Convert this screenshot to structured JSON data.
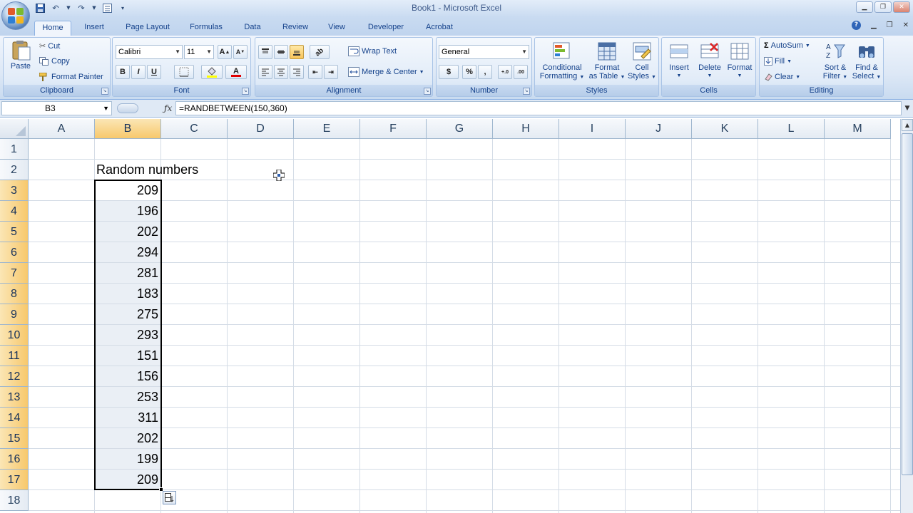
{
  "window": {
    "title": "Book1 - Microsoft Excel"
  },
  "tabs": [
    "Home",
    "Insert",
    "Page Layout",
    "Formulas",
    "Data",
    "Review",
    "View",
    "Developer",
    "Acrobat"
  ],
  "ribbon": {
    "clipboard": {
      "label": "Clipboard",
      "paste": "Paste",
      "cut": "Cut",
      "copy": "Copy",
      "format_painter": "Format Painter"
    },
    "font": {
      "label": "Font",
      "font_name": "Calibri",
      "font_size": "11",
      "bold": "B",
      "italic": "I",
      "underline": "U",
      "grow": "A",
      "shrink": "A",
      "font_color": "A"
    },
    "alignment": {
      "label": "Alignment",
      "wrap_text": "Wrap Text",
      "merge_center": "Merge & Center"
    },
    "number": {
      "label": "Number",
      "format": "General",
      "currency": "$",
      "percent": "%",
      "comma": ",",
      "inc_decimal": "+.0",
      "dec_decimal": ".00"
    },
    "styles": {
      "label": "Styles",
      "conditional_formatting": [
        "Conditional",
        "Formatting"
      ],
      "format_as_table": [
        "Format",
        "as Table"
      ],
      "cell_styles": [
        "Cell",
        "Styles"
      ]
    },
    "cells": {
      "label": "Cells",
      "insert": "Insert",
      "delete": "Delete",
      "format": "Format"
    },
    "editing": {
      "label": "Editing",
      "autosum": "AutoSum",
      "fill": "Fill",
      "clear": "Clear",
      "sort_filter": [
        "Sort &",
        "Filter"
      ],
      "find_select": [
        "Find &",
        "Select"
      ]
    }
  },
  "formula_bar": {
    "name_box": "B3",
    "formula": "=RANDBETWEEN(150,360)"
  },
  "sheet": {
    "columns": [
      "A",
      "B",
      "C",
      "D",
      "E",
      "F",
      "G",
      "H",
      "I",
      "J",
      "K",
      "L",
      "M"
    ],
    "rows": [
      "1",
      "2",
      "3",
      "4",
      "5",
      "6",
      "7",
      "8",
      "9",
      "10",
      "11",
      "12",
      "13",
      "14",
      "15",
      "16",
      "17",
      "18"
    ],
    "selected_column": "B",
    "header_cell": "Random numbers",
    "values": [
      "209",
      "196",
      "202",
      "294",
      "281",
      "183",
      "275",
      "293",
      "151",
      "156",
      "253",
      "311",
      "202",
      "199",
      "209"
    ]
  },
  "colors": {
    "accent": "#15428b",
    "selected_header": "#f7c86c",
    "ribbon_bg": "#dde8f6"
  },
  "icons": [
    "office-button-icon",
    "save-icon",
    "undo-icon",
    "redo-icon",
    "help-icon",
    "cursor-icon",
    "auto-fill-options-icon"
  ]
}
